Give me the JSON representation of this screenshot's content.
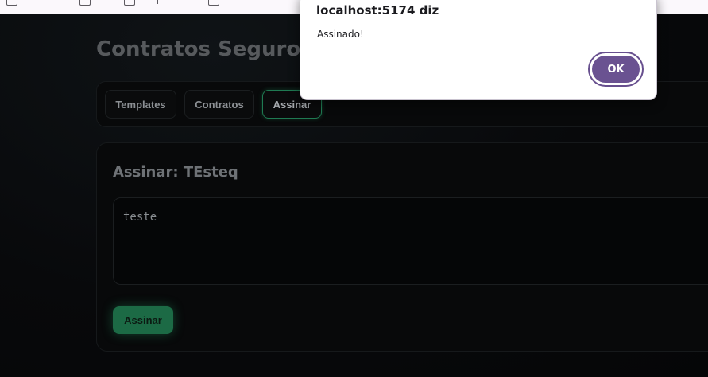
{
  "app": {
    "title": "Contratos Seguros"
  },
  "tabs": [
    {
      "label": "Templates",
      "active": false
    },
    {
      "label": "Contratos",
      "active": false
    },
    {
      "label": "Assinar",
      "active": true
    }
  ],
  "sign": {
    "title": "Assinar: TEsteq",
    "content": "teste",
    "button_label": "Assinar"
  },
  "dialog": {
    "title": "localhost:5174 diz",
    "message": "Assinado!",
    "ok_label": "OK"
  },
  "colors": {
    "accent_green": "#1c6a45",
    "dialog_purple": "#6a5291",
    "background": "#070809"
  }
}
